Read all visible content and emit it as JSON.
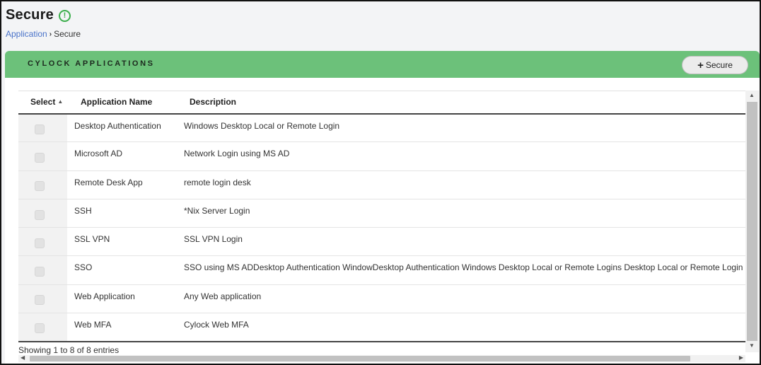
{
  "page": {
    "title": "Secure",
    "info_icon": "info-circle-icon",
    "info_glyph": "!"
  },
  "breadcrumb": {
    "link": "Application",
    "separator": "›",
    "current": "Secure"
  },
  "panel": {
    "title": "CYLOCK APPLICATIONS",
    "header_color": "#6cc17a",
    "secure_button": {
      "icon": "plus-icon",
      "glyph": "+",
      "label": "Secure"
    }
  },
  "table": {
    "columns": [
      "Select",
      "Application Name",
      "Description"
    ],
    "sort_glyph": "▲",
    "rows": [
      {
        "name": "Desktop Authentication",
        "description": "Windows Desktop Local or Remote Login"
      },
      {
        "name": "Microsoft AD",
        "description": "Network Login using MS AD"
      },
      {
        "name": "Remote Desk App",
        "description": "remote login desk"
      },
      {
        "name": "SSH",
        "description": "*Nix Server Login"
      },
      {
        "name": "SSL VPN",
        "description": "SSL VPN Login"
      },
      {
        "name": "SSO",
        "description": "SSO using MS ADDesktop Authentication WindowDesktop Authentication Windows Desktop Local or Remote Logins Desktop Local or Remote Login"
      },
      {
        "name": "Web Application",
        "description": "Any Web application"
      },
      {
        "name": "Web MFA",
        "description": "Cylock Web MFA"
      }
    ],
    "info": "Showing 1 to 8 of 8 entries"
  },
  "scroll": {
    "up": "▲",
    "down": "▼",
    "left": "◀",
    "right": "▶"
  }
}
